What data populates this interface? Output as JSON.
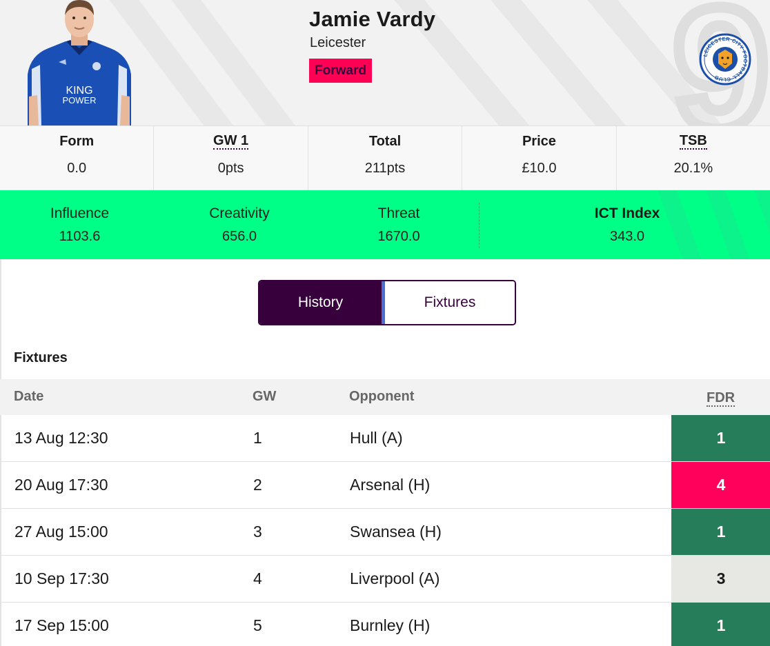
{
  "player": {
    "name": "Jamie Vardy",
    "team": "Leicester",
    "position": "Forward",
    "shirt_number": "9",
    "shirt_sponsor_line1": "KING",
    "shirt_sponsor_line2": "POWER",
    "club_badge_text": "LEICESTER CITY FOOTBALL CLUB"
  },
  "stats": [
    {
      "label": "Form",
      "value": "0.0",
      "dotted": false
    },
    {
      "label": "GW 1",
      "value": "0pts",
      "dotted": true
    },
    {
      "label": "Total",
      "value": "211pts",
      "dotted": false
    },
    {
      "label": "Price",
      "value": "£10.0",
      "dotted": false
    },
    {
      "label": "TSB",
      "value": "20.1%",
      "dotted": true
    }
  ],
  "ict": {
    "influence_label": "Influence",
    "influence_value": "1103.6",
    "creativity_label": "Creativity",
    "creativity_value": "656.0",
    "threat_label": "Threat",
    "threat_value": "1670.0",
    "index_label": "ICT Index",
    "index_value": "343.0"
  },
  "tabs": {
    "history": "History",
    "fixtures": "Fixtures",
    "active": "History"
  },
  "fixtures": {
    "title": "Fixtures",
    "headers": {
      "date": "Date",
      "gw": "GW",
      "opponent": "Opponent",
      "fdr": "FDR"
    },
    "rows": [
      {
        "date": "13 Aug 12:30",
        "gw": "1",
        "opponent": "Hull (A)",
        "fdr": "1",
        "fdr_color": "#257d5a",
        "fdr_text": "#ffffff"
      },
      {
        "date": "20 Aug 17:30",
        "gw": "2",
        "opponent": "Arsenal (H)",
        "fdr": "4",
        "fdr_color": "#ff005a",
        "fdr_text": "#ffffff"
      },
      {
        "date": "27 Aug 15:00",
        "gw": "3",
        "opponent": "Swansea (H)",
        "fdr": "1",
        "fdr_color": "#257d5a",
        "fdr_text": "#ffffff"
      },
      {
        "date": "10 Sep 17:30",
        "gw": "4",
        "opponent": "Liverpool (A)",
        "fdr": "3",
        "fdr_color": "#e7e7e3",
        "fdr_text": "#1a1a1a"
      },
      {
        "date": "17 Sep 15:00",
        "gw": "5",
        "opponent": "Burnley (H)",
        "fdr": "1",
        "fdr_color": "#257d5a",
        "fdr_text": "#ffffff"
      }
    ]
  },
  "colors": {
    "brand_purple": "#37003c",
    "brand_green": "#00ff87",
    "brand_pink": "#ff0055",
    "fdr_easy": "#257d5a",
    "fdr_hard": "#ff005a",
    "fdr_medium": "#e7e7e3"
  }
}
